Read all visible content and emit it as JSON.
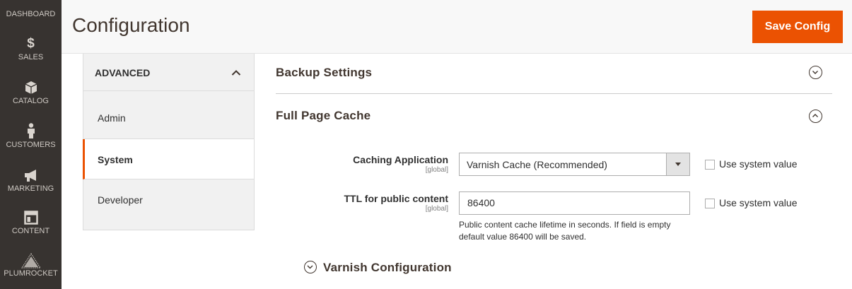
{
  "nav": {
    "items": [
      {
        "label": "DASHBOARD",
        "icon": "dashboard-icon"
      },
      {
        "label": "SALES",
        "icon": "dollar-icon"
      },
      {
        "label": "CATALOG",
        "icon": "box-icon"
      },
      {
        "label": "CUSTOMERS",
        "icon": "person-icon"
      },
      {
        "label": "MARKETING",
        "icon": "megaphone-icon"
      },
      {
        "label": "CONTENT",
        "icon": "layout-icon"
      },
      {
        "label": "PLUMROCKET",
        "icon": "pyramid-icon"
      }
    ],
    "sales_glyph": "$"
  },
  "header": {
    "title": "Configuration",
    "save_label": "Save Config"
  },
  "tabs": {
    "group_title": "ADVANCED",
    "items": [
      {
        "label": "Admin"
      },
      {
        "label": "System"
      },
      {
        "label": "Developer"
      }
    ]
  },
  "main": {
    "backup_title": "Backup Settings",
    "fpc_title": "Full Page Cache",
    "caching_label": "Caching Application",
    "caching_scope": "[global]",
    "caching_value": "Varnish Cache (Recommended)",
    "ttl_label": "TTL for public content",
    "ttl_scope": "[global]",
    "ttl_value": "86400",
    "use_system_label": "Use system value",
    "ttl_note": "Public content cache lifetime in seconds. If field is empty default value 86400 will be saved.",
    "varnish_title": "Varnish Configuration"
  },
  "colors": {
    "accent": "#eb5202",
    "nav_bg": "#373330"
  }
}
